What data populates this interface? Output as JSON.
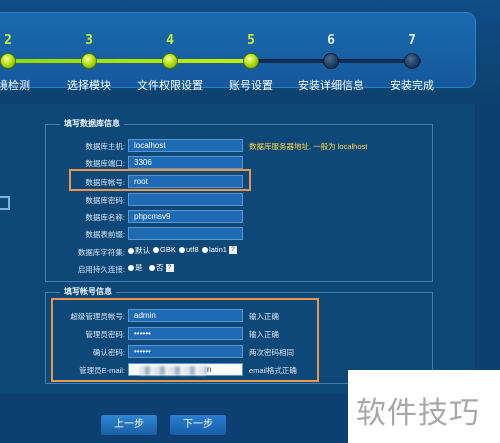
{
  "steps": [
    {
      "num": "2",
      "label": "环境检测",
      "done": true
    },
    {
      "num": "3",
      "label": "选择模块",
      "done": true
    },
    {
      "num": "4",
      "label": "文件权限设置",
      "done": true
    },
    {
      "num": "5",
      "label": "账号设置",
      "done": true
    },
    {
      "num": "6",
      "label": "安装详细信息",
      "done": false
    },
    {
      "num": "7",
      "label": "安装完成",
      "done": false
    }
  ],
  "db": {
    "legend": "填写数据库信息",
    "host_label": "数据库主机:",
    "host_value": "localhost",
    "host_hint": "数据库服务器地址, 一般为 localhost",
    "port_label": "数据库端口:",
    "port_value": "3306",
    "user_label": "数据库帐号:",
    "user_value": "root",
    "pass_label": "数据库密码:",
    "pass_value": "",
    "name_label": "数据库名称:",
    "name_value": "phpcmsv9",
    "prefix_label": "数据表前缀:",
    "prefix_value": "",
    "charset_label": "数据库字符集:",
    "charset_options": [
      "默认",
      "GBK",
      "utf8",
      "latin1"
    ],
    "persist_label": "启用持久连接:",
    "persist_options": [
      "是",
      "否"
    ],
    "help_glyph": "?"
  },
  "account": {
    "legend": "填写帐号信息",
    "admin_label": "超级管理员帐号:",
    "admin_value": "admin",
    "admin_hint": "输入正确",
    "pwd_label": "管理员密码:",
    "pwd_value": "••••••",
    "pwd_hint": "输入正确",
    "confirm_label": "确认密码:",
    "confirm_value": "••••••",
    "confirm_hint": "两次密码相同",
    "email_label": "管理员E-mail:",
    "email_value_suffix": "n",
    "email_hint": "email格式正确"
  },
  "buttons": {
    "prev": "上一步",
    "next": "下一步"
  },
  "watermark": "软件技巧"
}
